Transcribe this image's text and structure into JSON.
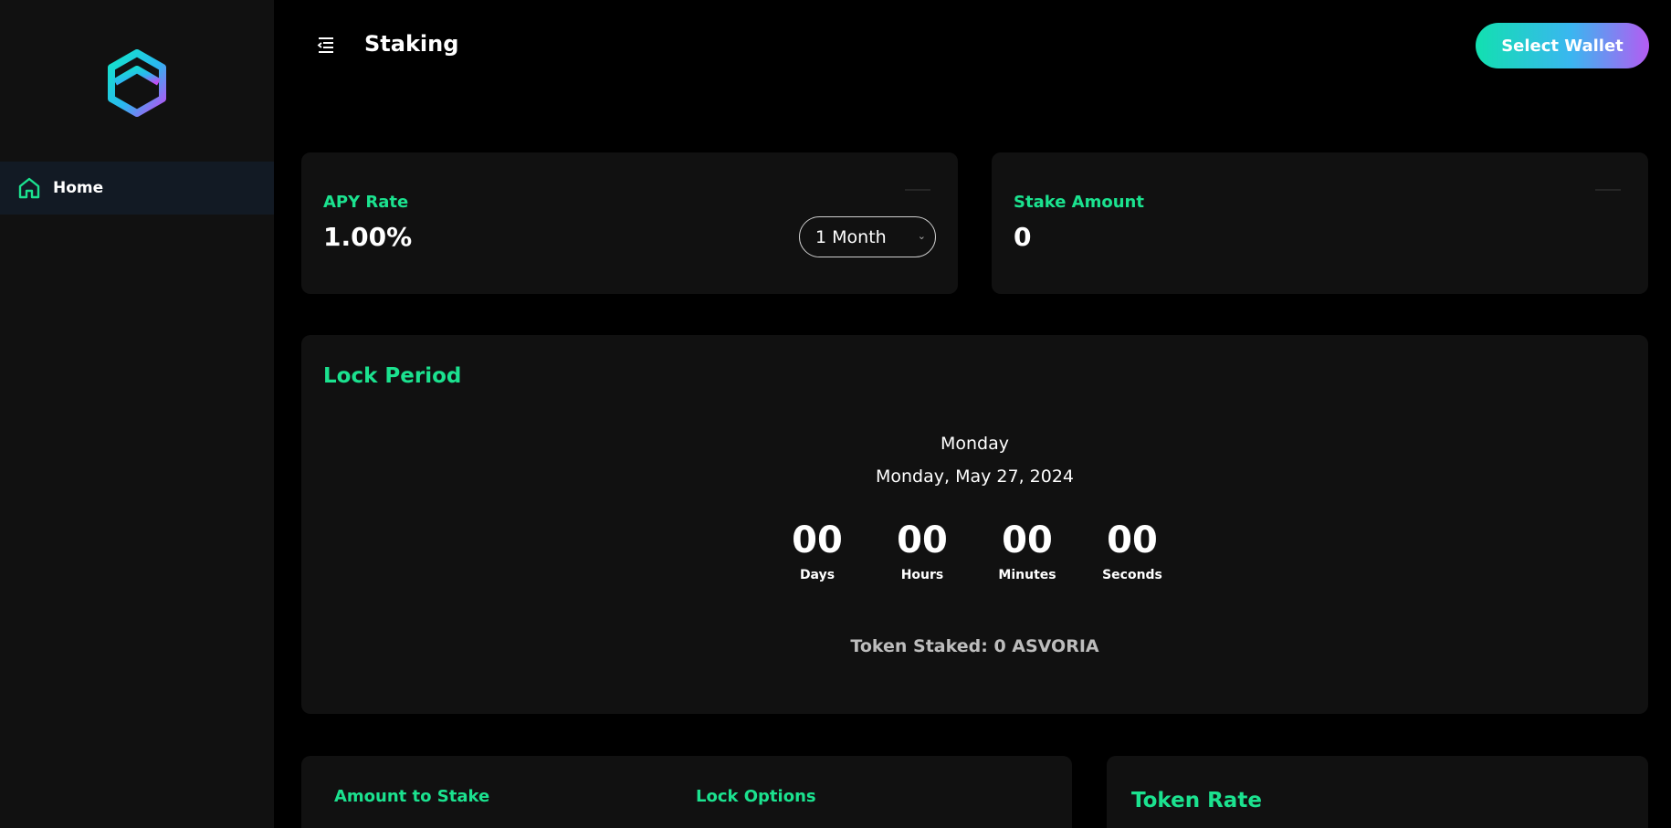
{
  "sidebar": {
    "logo_icon": "hexagon-logo-icon",
    "items": [
      {
        "label": "Home",
        "icon": "home-icon",
        "active": true
      }
    ]
  },
  "header": {
    "menu_icon": "menu-collapse-icon",
    "title": "Staking",
    "wallet_button": "Select Wallet"
  },
  "apy_card": {
    "label": "APY Rate",
    "value": "1.00%",
    "period_selected": "1 Month"
  },
  "stake_card": {
    "label": "Stake Amount",
    "value": "0"
  },
  "lock_period": {
    "title": "Lock Period",
    "day": "Monday",
    "date": "Monday, May 27, 2024",
    "countdown": [
      {
        "value": "00",
        "label": "Days"
      },
      {
        "value": "00",
        "label": "Hours"
      },
      {
        "value": "00",
        "label": "Minutes"
      },
      {
        "value": "00",
        "label": "Seconds"
      }
    ],
    "token_staked": "Token Staked: 0 ASVORIA"
  },
  "stake_form": {
    "amount_label": "Amount to Stake",
    "lock_options_label": "Lock Options"
  },
  "token_rate": {
    "title": "Token Rate"
  },
  "colors": {
    "accent_green": "#1be28f",
    "gradient_start": "#12e0b0",
    "gradient_end": "#b45cf2",
    "card_bg": "#111111",
    "page_bg": "#000000"
  }
}
